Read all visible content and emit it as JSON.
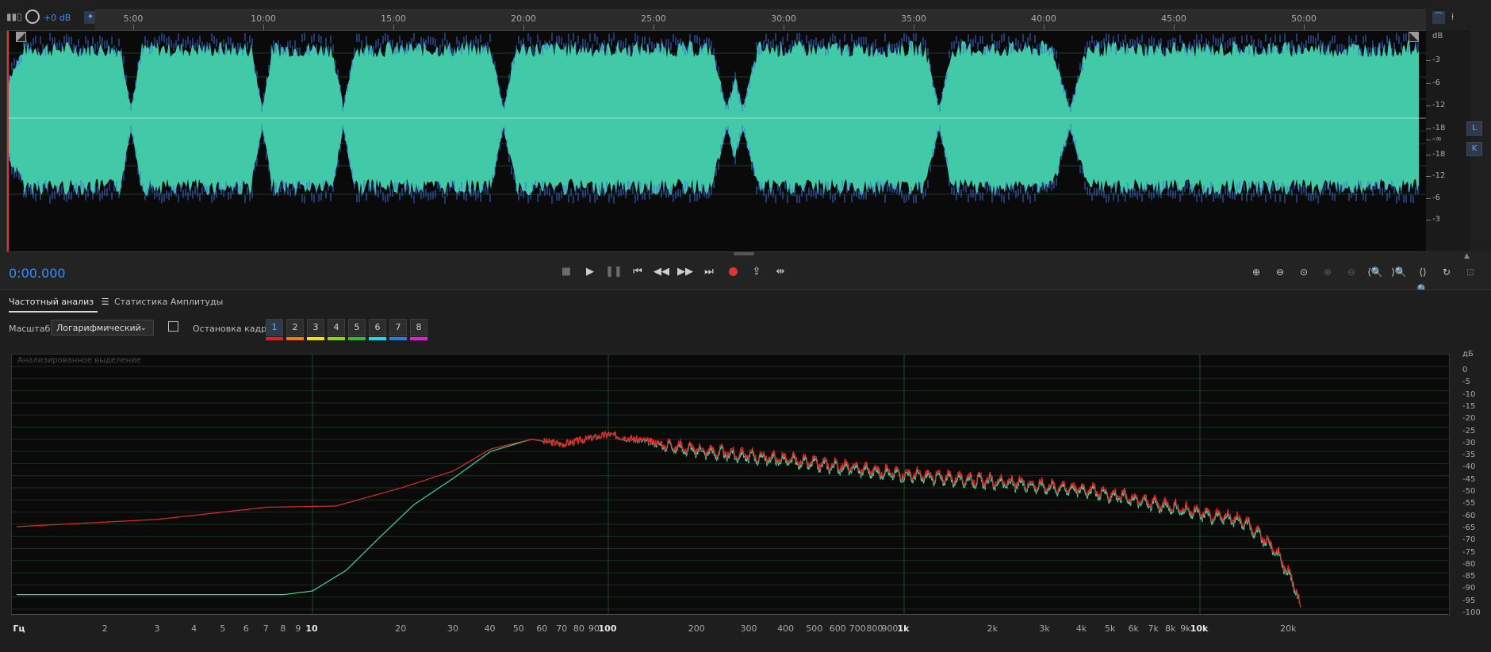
{
  "toolbar": {
    "gain_label": "+0 dB",
    "icons": [
      "levels-icon",
      "power-icon",
      "pin-icon",
      "snap-icon",
      "marker-icon"
    ]
  },
  "timeline": {
    "ticks": [
      "5:00",
      "10:00",
      "15:00",
      "20:00",
      "25:00",
      "30:00",
      "35:00",
      "40:00",
      "45:00",
      "50:00"
    ]
  },
  "wave_db_scale": {
    "unit": "dB",
    "labels": [
      "-3",
      "-6",
      "-12",
      "-18",
      "-∞",
      "-18",
      "-12",
      "-6",
      "-3"
    ]
  },
  "channels": {
    "left": "L",
    "right": "K"
  },
  "transport": {
    "time": "0:00.000",
    "record_color": "#e23333"
  },
  "tabs": {
    "frequency": "Частотный анализ",
    "amplitude": "Статистика Амплитуды"
  },
  "controls": {
    "scale_label": "Масштаб:",
    "scale_value": "Логарифмический",
    "frame_label": "Остановка кадра:",
    "frames": [
      "1",
      "2",
      "3",
      "4",
      "5",
      "6",
      "7",
      "8"
    ],
    "frame_colors": [
      "#e02020",
      "#f07a1a",
      "#f0e01a",
      "#8ed21a",
      "#3ab33a",
      "#20d8e8",
      "#2a7ae8",
      "#e020d0"
    ]
  },
  "spectrum": {
    "note": "Анализированное выделение",
    "db_unit": "дБ",
    "db_labels": [
      "0",
      "-5",
      "-10",
      "-15",
      "-20",
      "-25",
      "-30",
      "-35",
      "-40",
      "-45",
      "-50",
      "-55",
      "-60",
      "-65",
      "-70",
      "-75",
      "-80",
      "-85",
      "-90",
      "-95",
      "-100"
    ],
    "hz_labels": [
      "Гц",
      "2",
      "3",
      "4",
      "5",
      "6",
      "7",
      "8",
      "9",
      "10",
      "20",
      "30",
      "40",
      "50",
      "60",
      "70",
      "80",
      "90",
      "100",
      "200",
      "300",
      "400",
      "500",
      "600",
      "700",
      "800",
      "900",
      "1k",
      "2k",
      "3k",
      "4k",
      "5k",
      "6k",
      "7k",
      "8k",
      "9k",
      "10k",
      "20k"
    ],
    "hz_major": [
      "Гц",
      "10",
      "100",
      "1k",
      "10k"
    ]
  },
  "colors": {
    "waveform": "#42c9a8",
    "spectrum_red": "#e02a2a",
    "spectrum_green": "#3ad6a0",
    "accent": "#3a8cff"
  }
}
